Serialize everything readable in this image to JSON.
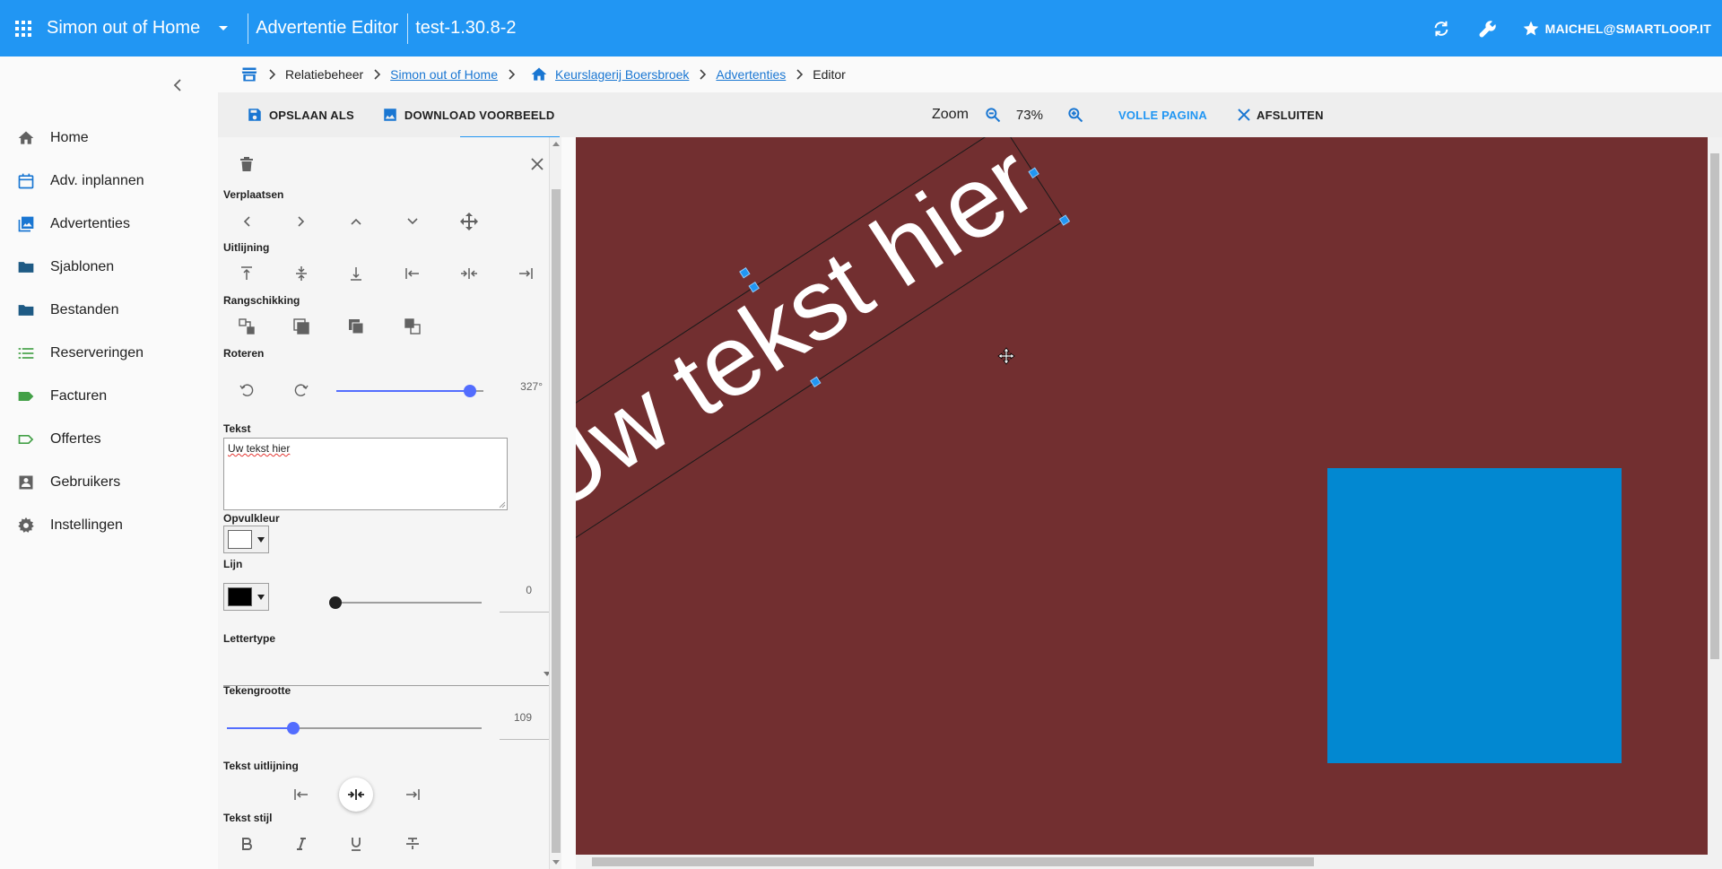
{
  "app": {
    "name": "Simon out of Home",
    "title": "Advertentie Editor",
    "version": "test-1.30.8-2",
    "user": "MAICHEL@SMARTLOOP.IT",
    "accent": "#2196f3"
  },
  "sidebar": {
    "items": [
      {
        "label": "Home",
        "icon": "home-icon"
      },
      {
        "label": "Adv. inplannen",
        "icon": "calendar-icon"
      },
      {
        "label": "Advertenties",
        "icon": "images-icon"
      },
      {
        "label": "Sjablonen",
        "icon": "folder-icon"
      },
      {
        "label": "Bestanden",
        "icon": "folder-icon"
      },
      {
        "label": "Reserveringen",
        "icon": "list-icon"
      },
      {
        "label": "Facturen",
        "icon": "label-icon"
      },
      {
        "label": "Offertes",
        "icon": "label-outline-icon"
      },
      {
        "label": "Gebruikers",
        "icon": "account-box-icon"
      },
      {
        "label": "Instellingen",
        "icon": "gear-icon"
      }
    ]
  },
  "breadcrumb": {
    "items": [
      "Relatiebeheer",
      "Simon out of Home",
      "Keurslagerij Boersbroek",
      "Advertenties",
      "Editor"
    ]
  },
  "toolbar": {
    "save_as": "OPSLAAN ALS",
    "download": "DOWNLOAD VOORBEELD",
    "zoom_label": "Zoom",
    "zoom_value": "73%",
    "full_page": "VOLLE PAGINA",
    "close": "AFSLUITEN"
  },
  "panel": {
    "move_label": "Verplaatsen",
    "align_label": "Uitlijning",
    "order_label": "Rangschikking",
    "rotate_label": "Roteren",
    "rotate_value": "327°",
    "rotate_fraction": 0.908,
    "text_label": "Tekst",
    "text_value": "Uw tekst hier",
    "fill_label": "Opvulkleur",
    "fill_color": "#ffffff",
    "line_label": "Lijn",
    "line_color": "#000000",
    "line_value": "0",
    "line_fraction": 0,
    "font_label": "Lettertype",
    "size_label": "Tekengrootte",
    "size_value": "109",
    "size_fraction": 0.26,
    "text_align_label": "Tekst uitlijning",
    "text_style_label": "Tekst stijl"
  },
  "canvas": {
    "background": "#722f30",
    "text": "Uw tekst hier",
    "text_color": "#ffffff",
    "rotation_deg": -33,
    "rect_color": "#0288d1"
  }
}
